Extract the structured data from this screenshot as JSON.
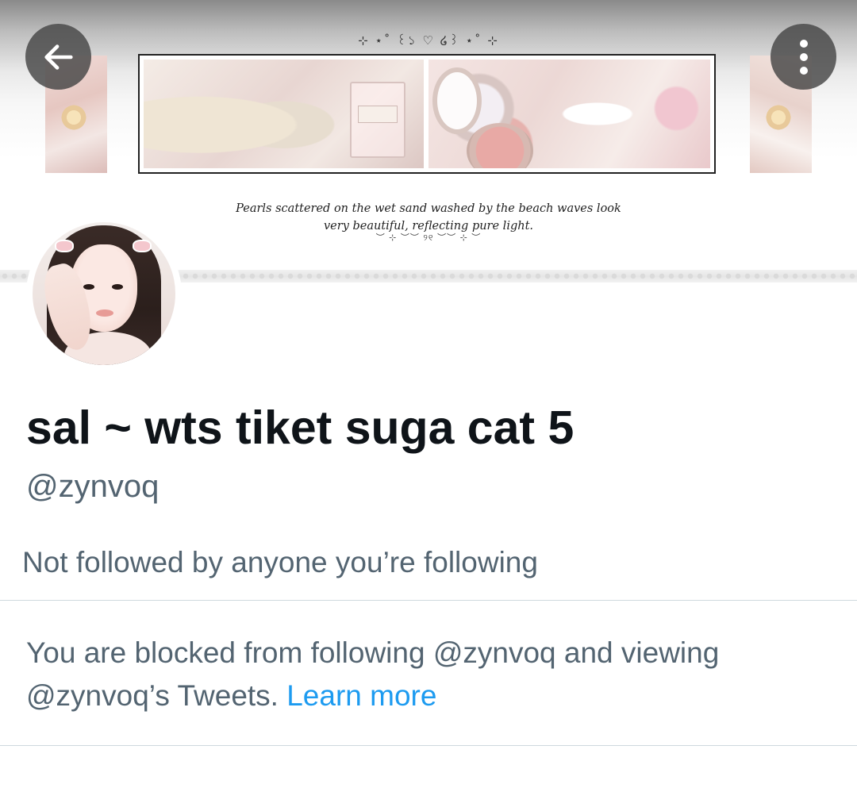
{
  "banner": {
    "top_ornament": "⊹ ⋆˚ ꒰১ ♡ ໒꒱ ⋆˚ ⊹",
    "quote_line1": "Pearls scattered on the wet sand washed by the beach waves look",
    "quote_line2": "very beautiful, reflecting pure light.",
    "bottom_ornament": "︶ ⊹ ︶︶ ୨୧ ︶︶ ⊹ ︶"
  },
  "nav": {
    "back_icon": "arrow-left-icon",
    "more_icon": "more-vertical-icon"
  },
  "profile": {
    "display_name": "sal ~ wts tiket suga cat 5",
    "handle": "@zynvoq",
    "followed_by": "Not followed by anyone you’re following"
  },
  "blocked_notice": {
    "text": "You are blocked from following @zynvoq and viewing @zynvoq’s Tweets.",
    "link": "Learn more"
  },
  "colors": {
    "text_primary": "#0f1419",
    "text_secondary": "#536471",
    "link": "#1d9bf0",
    "divider": "#cfd9de"
  }
}
